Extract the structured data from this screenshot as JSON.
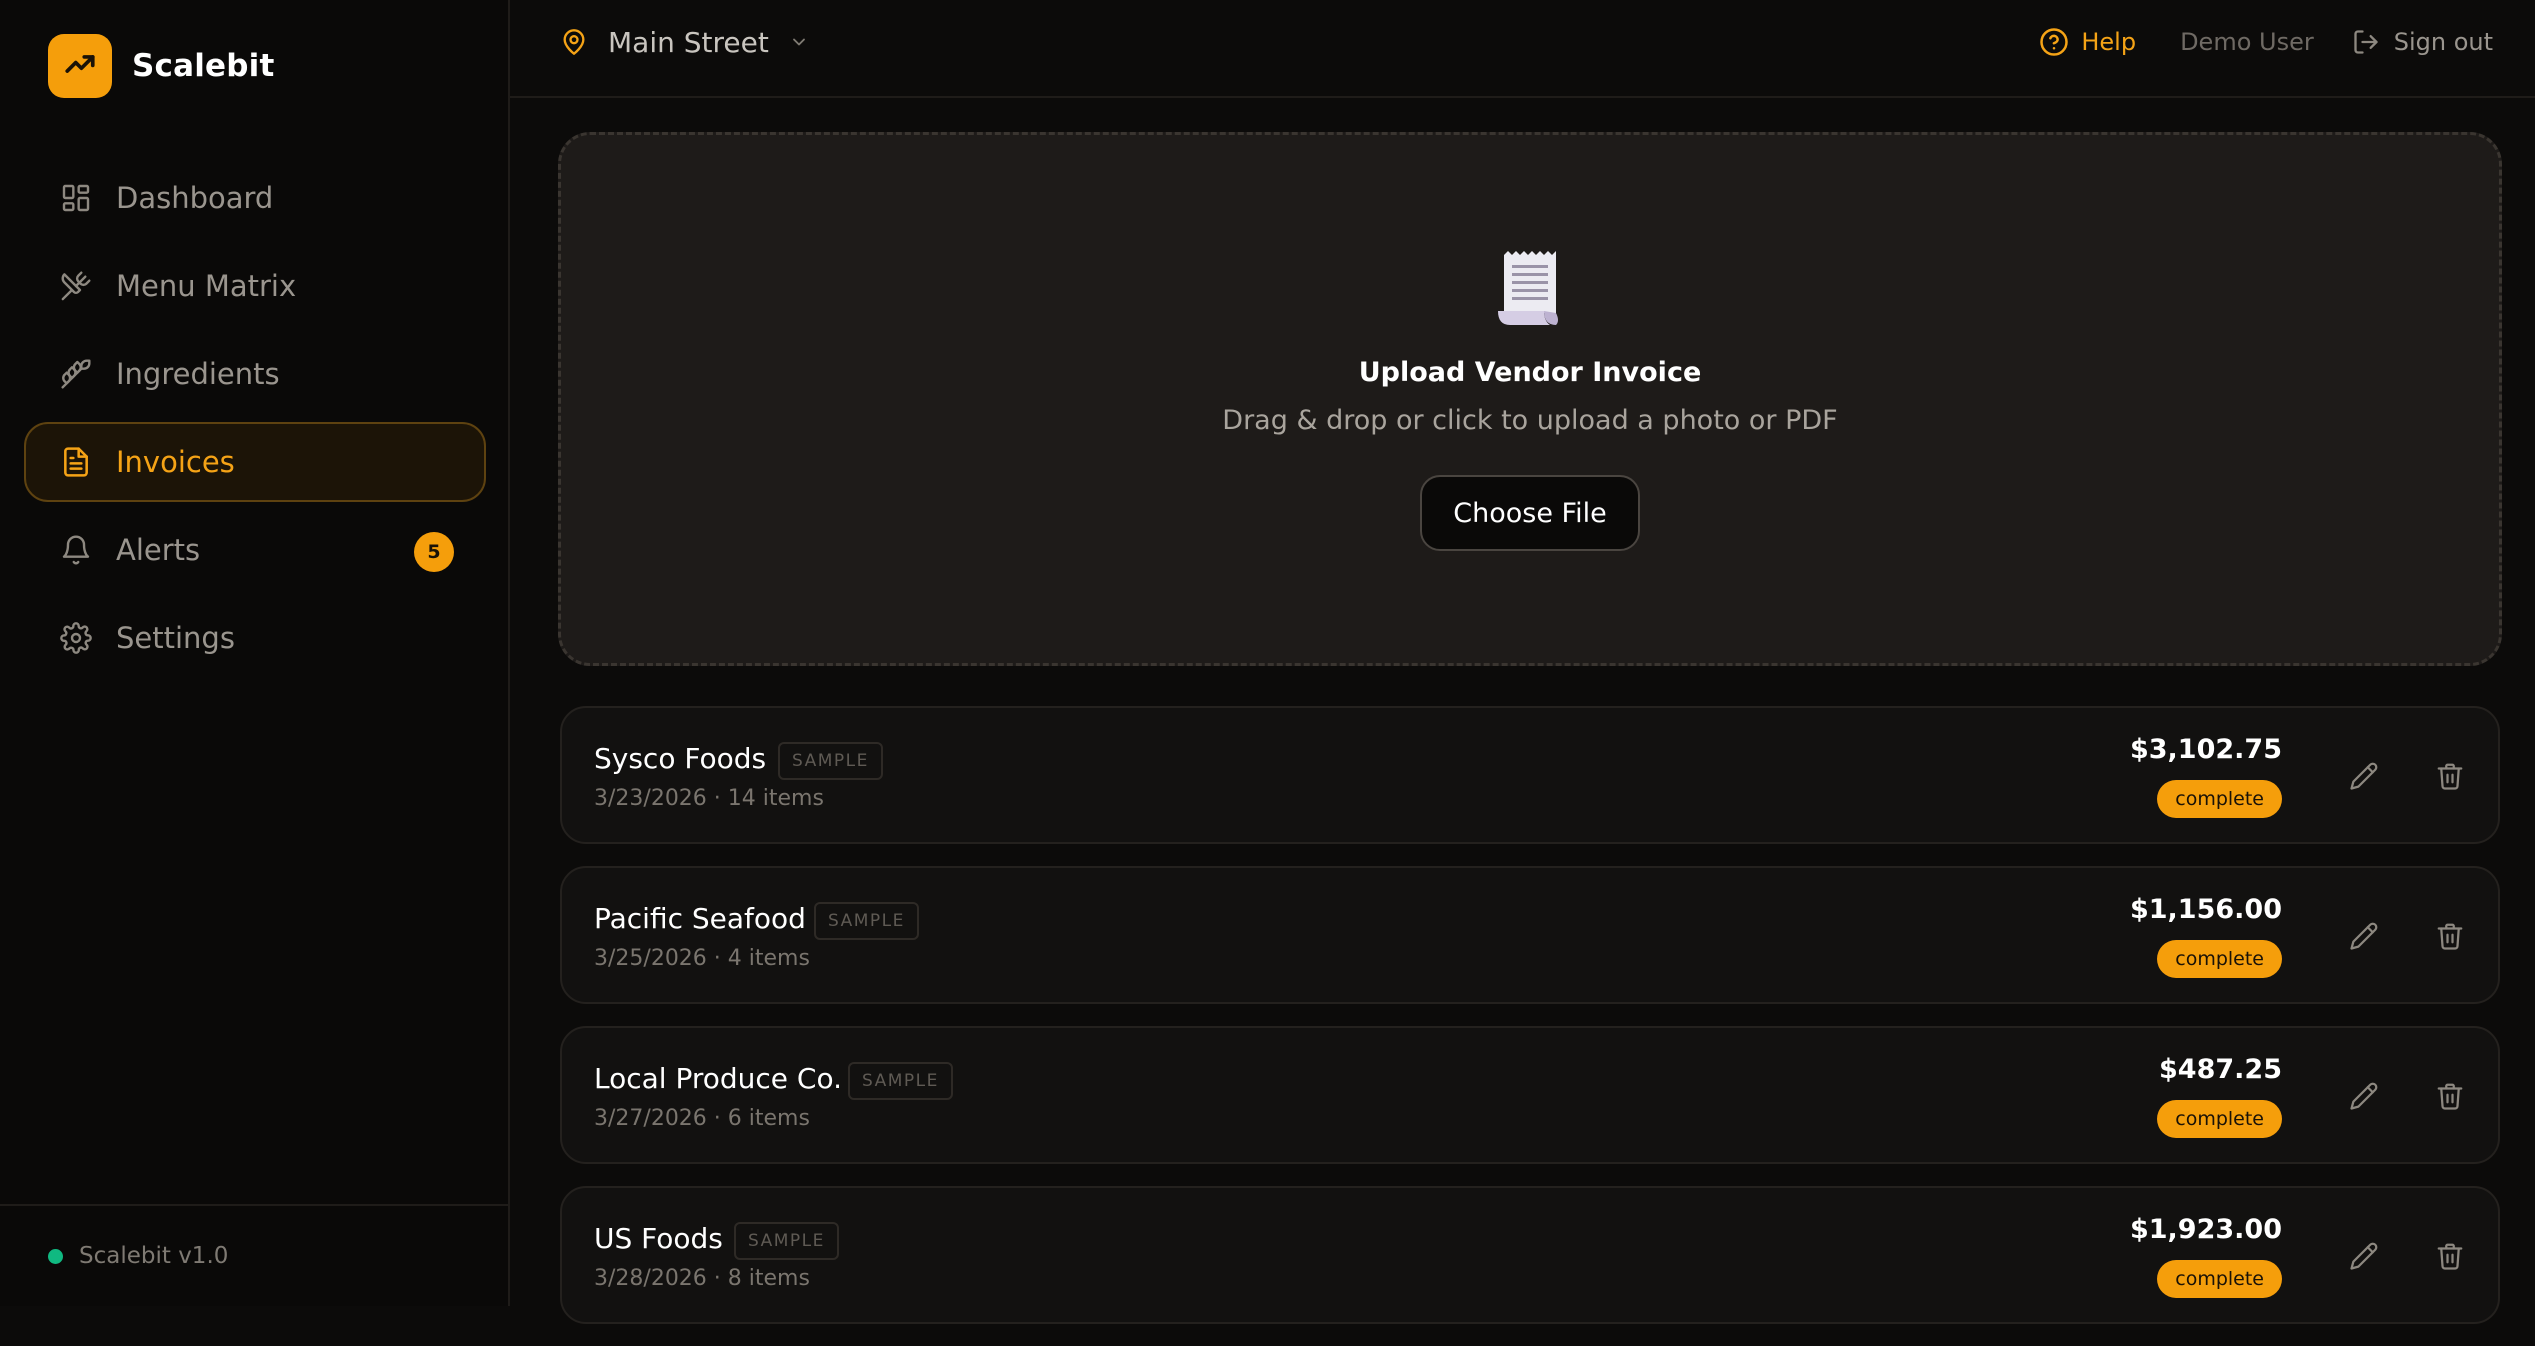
{
  "brand": {
    "name": "Scalebit",
    "logo_icon": "trending-up-icon",
    "accent_color": "#f59e0b"
  },
  "sidebar": {
    "items": [
      {
        "label": "Dashboard",
        "icon": "dashboard-grid-icon",
        "active": false
      },
      {
        "label": "Menu Matrix",
        "icon": "utensils-crossed-icon",
        "active": false
      },
      {
        "label": "Ingredients",
        "icon": "wheat-icon",
        "active": false
      },
      {
        "label": "Invoices",
        "icon": "file-text-icon",
        "active": true
      },
      {
        "label": "Alerts",
        "icon": "bell-icon",
        "active": false,
        "badge": "5"
      },
      {
        "label": "Settings",
        "icon": "gear-icon",
        "active": false
      }
    ],
    "footer": {
      "version": "Scalebit v1.0",
      "status_color": "#10b981"
    }
  },
  "header": {
    "location": "Main Street",
    "help_label": "Help",
    "user_name": "Demo User",
    "signout_label": "Sign out"
  },
  "upload": {
    "icon": "receipt-icon",
    "title": "Upload Vendor Invoice",
    "subtitle": "Drag & drop or click to upload a photo or PDF",
    "button_label": "Choose File"
  },
  "invoices": [
    {
      "vendor": "Sysco Foods",
      "tag": "SAMPLE",
      "meta": "3/23/2026 · 14 items",
      "amount": "$3,102.75",
      "status": "complete"
    },
    {
      "vendor": "Pacific Seafood",
      "tag": "SAMPLE",
      "meta": "3/25/2026 · 4 items",
      "amount": "$1,156.00",
      "status": "complete"
    },
    {
      "vendor": "Local Produce Co.",
      "tag": "SAMPLE",
      "meta": "3/27/2026 · 6 items",
      "amount": "$487.25",
      "status": "complete"
    },
    {
      "vendor": "US Foods",
      "tag": "SAMPLE",
      "meta": "3/28/2026 · 8 items",
      "amount": "$1,923.00",
      "status": "complete"
    }
  ]
}
